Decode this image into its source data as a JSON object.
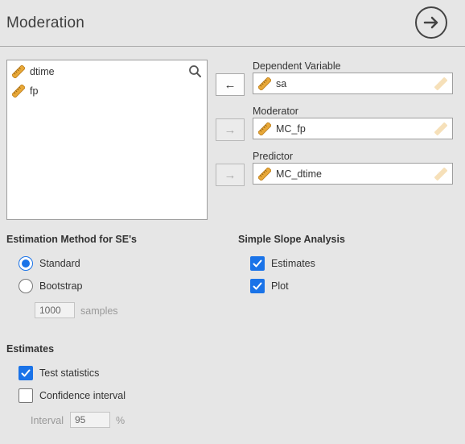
{
  "header": {
    "title": "Moderation",
    "run_icon": "arrow-right-circle-icon"
  },
  "variables": {
    "items": [
      {
        "label": "dtime",
        "icon": "ruler-icon"
      },
      {
        "label": "fp",
        "icon": "ruler-icon"
      }
    ]
  },
  "targets": {
    "dependent": {
      "label": "Dependent Variable",
      "value": "sa",
      "arrow": "←"
    },
    "moderator": {
      "label": "Moderator",
      "value": "MC_fp",
      "arrow": "→"
    },
    "predictor": {
      "label": "Predictor",
      "value": "MC_dtime",
      "arrow": "→"
    }
  },
  "estimation": {
    "title": "Estimation Method for SE's",
    "standard": {
      "label": "Standard",
      "selected": true
    },
    "bootstrap": {
      "label": "Bootstrap",
      "selected": false
    },
    "samples_value": "1000",
    "samples_label": "samples"
  },
  "simple_slope": {
    "title": "Simple Slope Analysis",
    "estimates": {
      "label": "Estimates",
      "checked": true
    },
    "plot": {
      "label": "Plot",
      "checked": true
    }
  },
  "estimates": {
    "title": "Estimates",
    "test_statistics": {
      "label": "Test statistics",
      "checked": true
    },
    "confidence_interval": {
      "label": "Confidence interval",
      "checked": false
    },
    "interval_label": "Interval",
    "interval_value": "95",
    "interval_unit": "%"
  },
  "colors": {
    "accent": "#1a73e8",
    "ruler": "#e8a838",
    "background": "#e6e6e6"
  }
}
